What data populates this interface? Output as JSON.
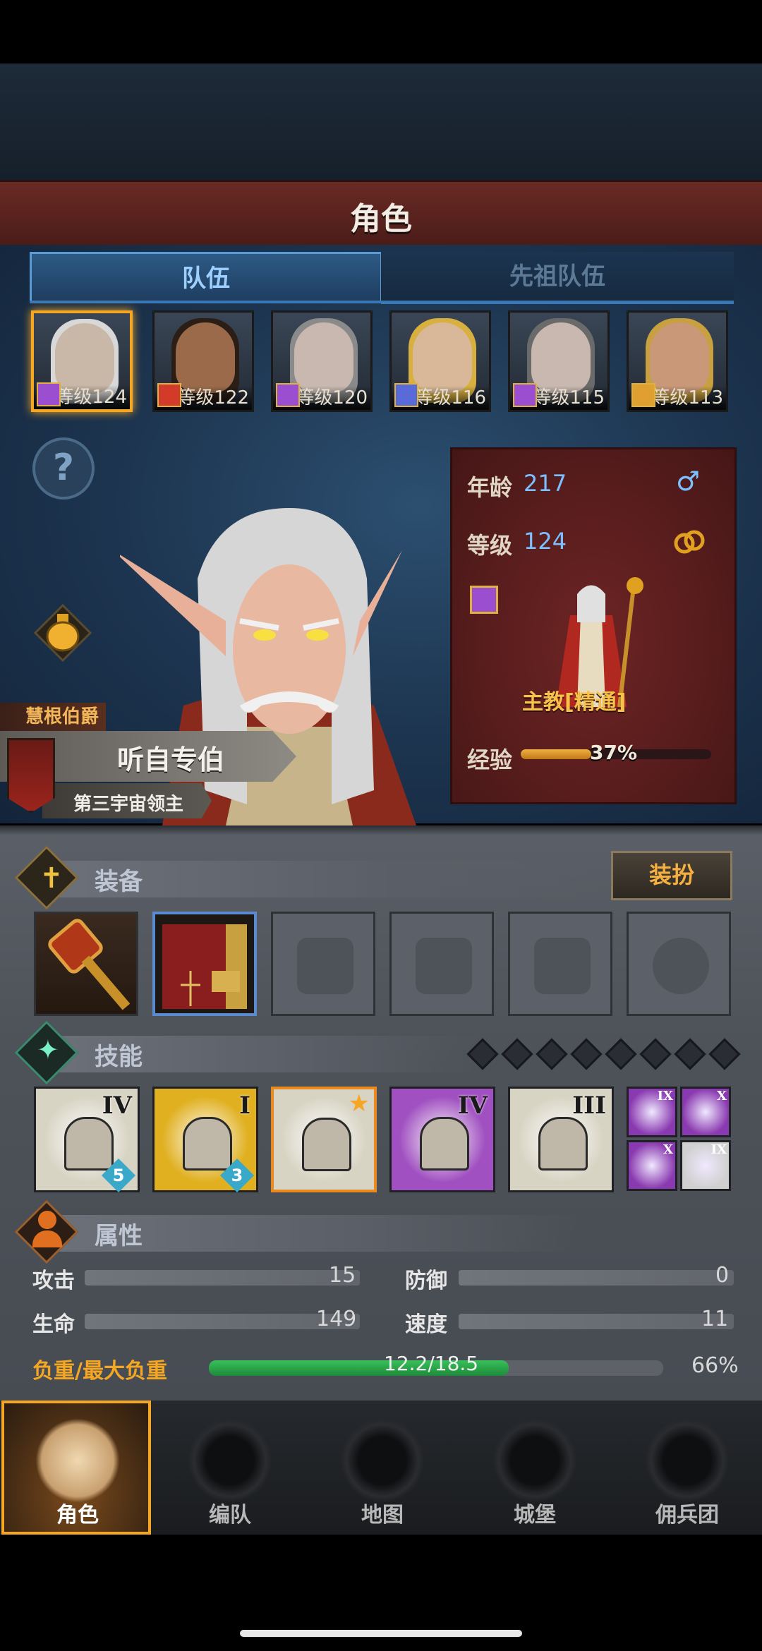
{
  "header": {
    "title": "角色"
  },
  "tabs": {
    "team": "队伍",
    "ancestor": "先祖队伍"
  },
  "party": [
    {
      "level_text": "等级124",
      "class_color": "#9b4fd0",
      "face": "#c9b8a8",
      "hair": "#d8d8d8",
      "selected": true
    },
    {
      "level_text": "等级122",
      "class_color": "#d23a2a",
      "face": "#9a6a4a",
      "hair": "#2a1e16",
      "selected": false
    },
    {
      "level_text": "等级120",
      "class_color": "#9b4fd0",
      "face": "#c8b8b0",
      "hair": "#8a8a8a",
      "selected": false
    },
    {
      "level_text": "等级116",
      "class_color": "#5a6ad8",
      "face": "#d8b898",
      "hair": "#d8b040",
      "selected": false
    },
    {
      "level_text": "等级115",
      "class_color": "#9b4fd0",
      "face": "#c8b8b0",
      "hair": "#6a6a6a",
      "selected": false
    },
    {
      "level_text": "等级113",
      "class_color": "#e0a030",
      "face": "#c89878",
      "hair": "#c8a040",
      "selected": false
    }
  ],
  "help": {
    "glyph": "?"
  },
  "character": {
    "title": "慧根伯爵",
    "name": "听自专伯",
    "subtitle": "第三宇宙领主",
    "age_label": "年龄",
    "age": "217",
    "gender_icon": "♂",
    "level_label": "等级",
    "level": "124",
    "job": "主教[精通]",
    "exp_label": "经验",
    "exp_percent": 37,
    "exp_text": "37%"
  },
  "equipment": {
    "title": "装备",
    "dress_button": "装扮",
    "slots": [
      "mace",
      "tome",
      "helmet",
      "armor",
      "boots",
      "ring"
    ]
  },
  "skills": {
    "title": "技能",
    "points": 8,
    "items": [
      {
        "rank": "IV",
        "badge": "5",
        "bg": "#d8d4c4"
      },
      {
        "rank": "I",
        "badge": "3",
        "bg": "#e0b020"
      },
      {
        "rank": "",
        "badge": "",
        "bg": "#d8d4c4",
        "starred": true
      },
      {
        "rank": "IV",
        "badge": "",
        "bg": "#a050c0"
      },
      {
        "rank": "III",
        "badge": "",
        "bg": "#d8d4c4"
      }
    ],
    "mini": [
      {
        "rank": "IX",
        "bg": "#8a3ab0"
      },
      {
        "rank": "X",
        "bg": "#8a3ab0"
      },
      {
        "rank": "X",
        "bg": "#8a3ab0"
      },
      {
        "rank": "IX",
        "bg": "#d0d0d0"
      }
    ]
  },
  "attributes": {
    "title": "属性",
    "attack_label": "攻击",
    "attack": "15",
    "defense_label": "防御",
    "defense": "0",
    "hp_label": "生命",
    "hp": "149",
    "speed_label": "速度",
    "speed": "11",
    "load_label": "负重/最大负重",
    "load_text": "12.2/18.5",
    "load_percent": 66,
    "load_percent_text": "66%"
  },
  "nav": [
    {
      "label": "角色",
      "selected": true
    },
    {
      "label": "编队",
      "selected": false
    },
    {
      "label": "地图",
      "selected": false
    },
    {
      "label": "城堡",
      "selected": false
    },
    {
      "label": "佣兵团",
      "selected": false
    }
  ],
  "colors": {
    "accent": "#f5a623",
    "blue": "#7cc0ff",
    "load_green": "#2ea84a"
  }
}
